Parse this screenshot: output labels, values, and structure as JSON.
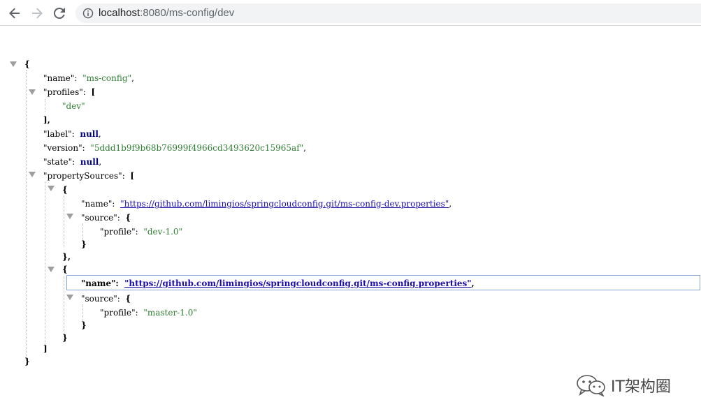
{
  "browser": {
    "url_host": "localhost",
    "url_rest": ":8080/ms-config/dev"
  },
  "json": {
    "open_brace": "{",
    "close_brace": "}",
    "name_key": "\"name\":",
    "name_val": "\"ms-config\"",
    "profiles_key": "\"profiles\":",
    "profiles_open": "[",
    "profile_item": "\"dev\"",
    "profiles_close": "],",
    "label_key": "\"label\":",
    "label_val": "null",
    "version_key": "\"version\":",
    "version_val": "\"5ddd1b9f9b68b76999f4966cd3493620c15965af\"",
    "state_key": "\"state\":",
    "state_val": "null",
    "ps_key": "\"propertySources\":",
    "ps_open": "[",
    "ps_close": "]",
    "sources": [
      {
        "open": "{",
        "name_key": "\"name\":",
        "name_val": "\"https://github.com/limingios/springcloudconfig.git/ms-config-dev.properties\"",
        "source_key": "\"source\":",
        "source_open": "{",
        "profile_key": "\"profile\":",
        "profile_val": "\"dev-1.0\"",
        "source_close": "}",
        "close": "},"
      },
      {
        "open": "{",
        "name_key": "\"name\":",
        "name_val": "\"https://github.com/limingios/springcloudconfig.git/ms-config.properties\"",
        "source_key": "\"source\":",
        "source_open": "{",
        "profile_key": "\"profile\":",
        "profile_val": "\"master-1.0\"",
        "source_close": "}",
        "close": "}"
      }
    ],
    "comma": ","
  },
  "watermark": {
    "text": "IT架构圈",
    "icon": "wechat-icon"
  }
}
